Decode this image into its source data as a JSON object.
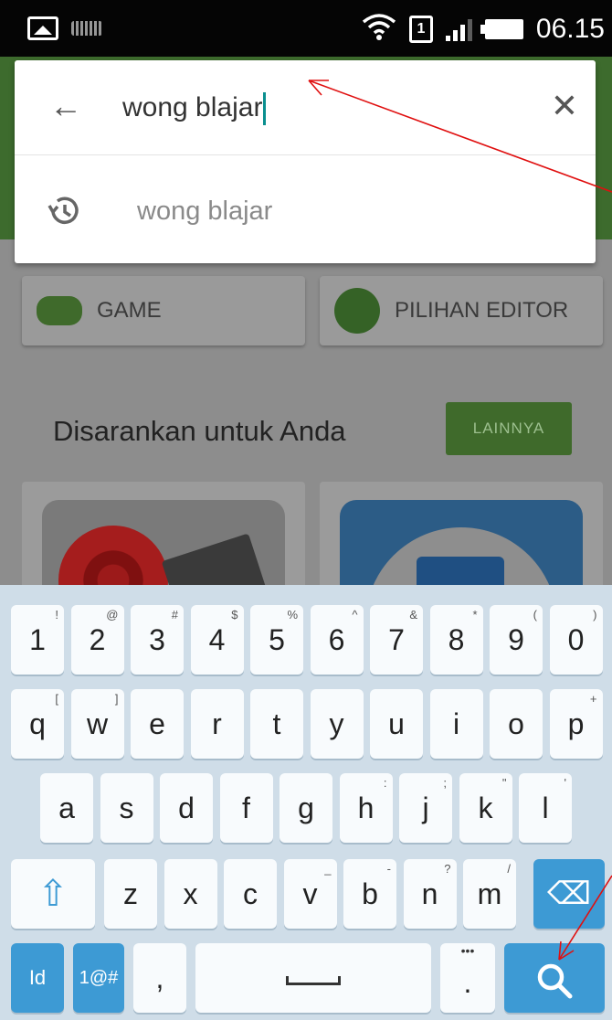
{
  "status_bar": {
    "time": "06.15",
    "sim_label": "1",
    "icons": [
      "image-notification-icon",
      "keyboard-notification-icon",
      "wifi-icon",
      "sim-icon",
      "signal-icon",
      "battery-icon"
    ]
  },
  "search": {
    "query": "wong blajar",
    "back_icon": "←",
    "clear_icon": "✕",
    "suggestion_icon": "history-icon",
    "suggestions": [
      {
        "text": "wong blajar"
      }
    ]
  },
  "categories": [
    {
      "label": "GAME",
      "icon": "gamepad-icon"
    },
    {
      "label": "PILIHAN EDITOR",
      "icon": "editor-choice-icon"
    }
  ],
  "recommended": {
    "title": "Disarankan untuk Anda",
    "more_button": "LAINNYA"
  },
  "keyboard": {
    "row1": [
      {
        "k": "1",
        "s": "!"
      },
      {
        "k": "2",
        "s": "@"
      },
      {
        "k": "3",
        "s": "#"
      },
      {
        "k": "4",
        "s": "$"
      },
      {
        "k": "5",
        "s": "%"
      },
      {
        "k": "6",
        "s": "^"
      },
      {
        "k": "7",
        "s": "&"
      },
      {
        "k": "8",
        "s": "*"
      },
      {
        "k": "9",
        "s": "("
      },
      {
        "k": "0",
        "s": ")"
      }
    ],
    "row2": [
      {
        "k": "q",
        "s": "["
      },
      {
        "k": "w",
        "s": "]"
      },
      {
        "k": "e",
        "s": ""
      },
      {
        "k": "r",
        "s": ""
      },
      {
        "k": "t",
        "s": ""
      },
      {
        "k": "y",
        "s": ""
      },
      {
        "k": "u",
        "s": ""
      },
      {
        "k": "i",
        "s": ""
      },
      {
        "k": "o",
        "s": ""
      },
      {
        "k": "p",
        "s": "+"
      }
    ],
    "row3": [
      {
        "k": "a",
        "s": ""
      },
      {
        "k": "s",
        "s": ""
      },
      {
        "k": "d",
        "s": ""
      },
      {
        "k": "f",
        "s": ""
      },
      {
        "k": "g",
        "s": ""
      },
      {
        "k": "h",
        "s": ":"
      },
      {
        "k": "j",
        "s": ";"
      },
      {
        "k": "k",
        "s": "\""
      },
      {
        "k": "l",
        "s": "'"
      }
    ],
    "row4": [
      {
        "k": "z",
        "s": ""
      },
      {
        "k": "x",
        "s": ""
      },
      {
        "k": "c",
        "s": ""
      },
      {
        "k": "v",
        "s": "_"
      },
      {
        "k": "b",
        "s": "-"
      },
      {
        "k": "n",
        "s": "?"
      },
      {
        "k": "m",
        "s": "/"
      }
    ],
    "shift_icon": "⇧",
    "backspace_icon": "⌫",
    "lang_key": "Id",
    "symbols_key": "1@#",
    "comma_key": ",",
    "period_key": ".",
    "period_sub": "•••",
    "search_icon": "search-icon"
  },
  "colors": {
    "accent_green": "#3f6a2b",
    "keyboard_bg": "#cfdde8",
    "key_blue": "#3d9ad4",
    "caret": "#0a8f8f",
    "annotation_red": "#e01010"
  }
}
